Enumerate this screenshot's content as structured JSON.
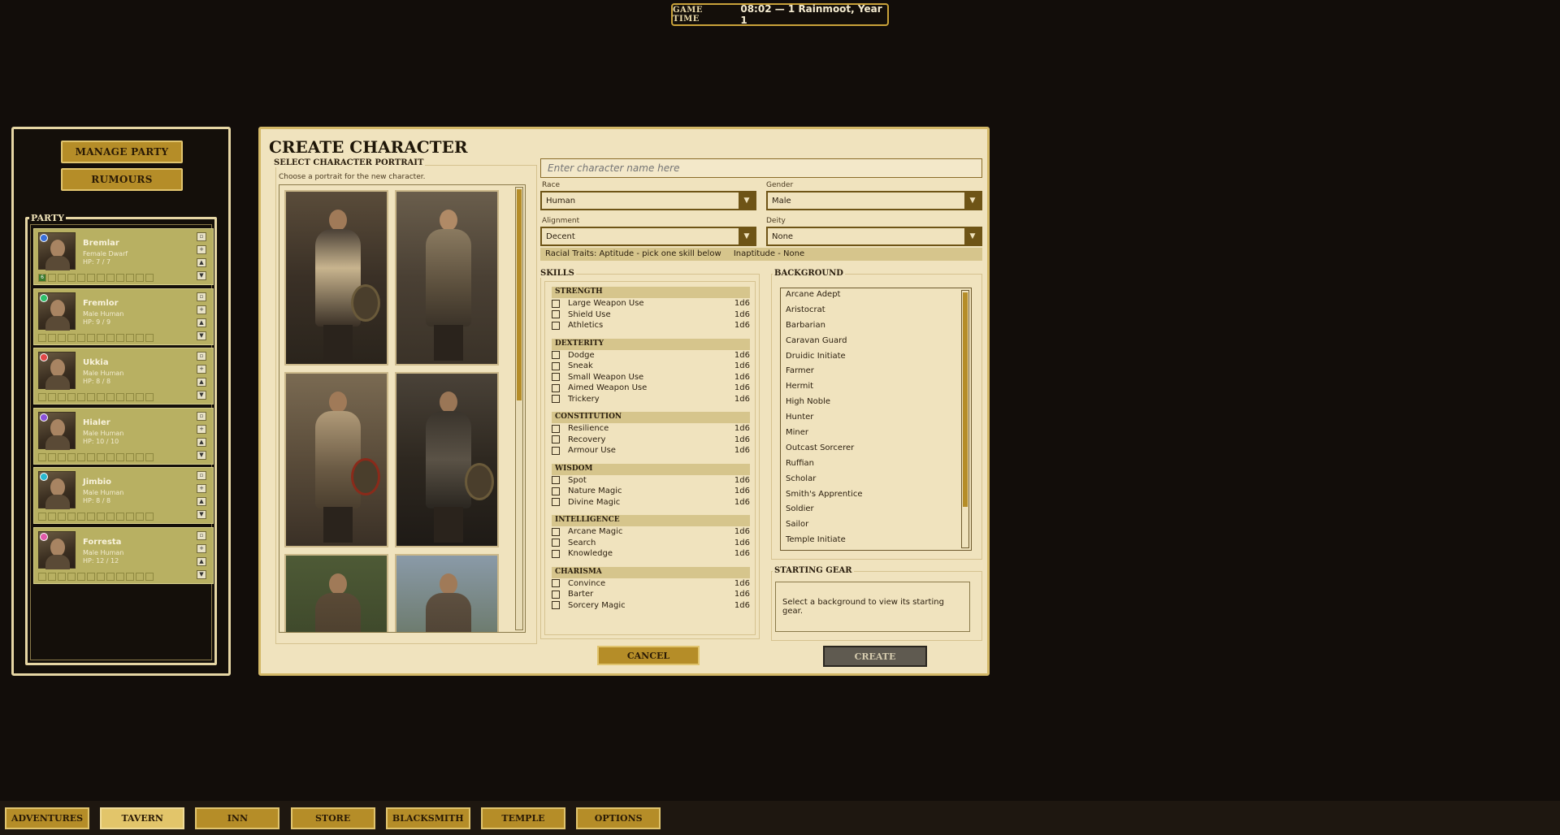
{
  "game_time": {
    "label": "GAME TIME",
    "value": "08:02 — 1 Rainmoot, Year 1"
  },
  "left_panel": {
    "manage_party": "MANAGE PARTY",
    "rumours": "RUMOURS",
    "party_title": "PARTY",
    "members": [
      {
        "name": "Bremlar",
        "info": "Female   Dwarf",
        "hp": "HP:  7 / 7",
        "dot_color": "#3a6fd8",
        "badge": "6"
      },
      {
        "name": "Fremlor",
        "info": "Male   Human",
        "hp": "HP:  9 / 9",
        "dot_color": "#2fbf6a",
        "badge": ""
      },
      {
        "name": "Ukkia",
        "info": "Male   Human",
        "hp": "HP:  8 / 8",
        "dot_color": "#e04848",
        "badge": ""
      },
      {
        "name": "Hialer",
        "info": "Male   Human",
        "hp": "HP:  10 / 10",
        "dot_color": "#8a52d8",
        "badge": ""
      },
      {
        "name": "Jimbio",
        "info": "Male   Human",
        "hp": "HP:  8 / 8",
        "dot_color": "#2ab8d0",
        "badge": ""
      },
      {
        "name": "Forresta",
        "info": "Male   Human",
        "hp": "HP:  12 / 12",
        "dot_color": "#e05aa8",
        "badge": ""
      }
    ]
  },
  "create": {
    "title": "CREATE CHARACTER",
    "portrait_label": "SELECT CHARACTER PORTRAIT",
    "portrait_hint": "Choose a portrait for the new character.",
    "name_placeholder": "Enter character name here",
    "race_label": "Race",
    "race_value": "Human",
    "gender_label": "Gender",
    "gender_value": "Male",
    "alignment_label": "Alignment",
    "alignment_value": "Decent",
    "deity_label": "Deity",
    "deity_value": "None",
    "traits_aptitude": "Racial Traits: Aptitude - pick one skill below",
    "traits_inaptitude": "Inaptitude - None",
    "skills_label": "SKILLS",
    "skill_groups": [
      {
        "name": "STRENGTH",
        "skills": [
          [
            "Large Weapon Use",
            "1d6"
          ],
          [
            "Shield Use",
            "1d6"
          ],
          [
            "Athletics",
            "1d6"
          ]
        ]
      },
      {
        "name": "DEXTERITY",
        "skills": [
          [
            "Dodge",
            "1d6"
          ],
          [
            "Sneak",
            "1d6"
          ],
          [
            "Small Weapon Use",
            "1d6"
          ],
          [
            "Aimed Weapon Use",
            "1d6"
          ],
          [
            "Trickery",
            "1d6"
          ]
        ]
      },
      {
        "name": "CONSTITUTION",
        "skills": [
          [
            "Resilience",
            "1d6"
          ],
          [
            "Recovery",
            "1d6"
          ],
          [
            "Armour Use",
            "1d6"
          ]
        ]
      },
      {
        "name": "WISDOM",
        "skills": [
          [
            "Spot",
            "1d6"
          ],
          [
            "Nature Magic",
            "1d6"
          ],
          [
            "Divine Magic",
            "1d6"
          ]
        ]
      },
      {
        "name": "INTELLIGENCE",
        "skills": [
          [
            "Arcane Magic",
            "1d6"
          ],
          [
            "Search",
            "1d6"
          ],
          [
            "Knowledge",
            "1d6"
          ]
        ]
      },
      {
        "name": "CHARISMA",
        "skills": [
          [
            "Convince",
            "1d6"
          ],
          [
            "Barter",
            "1d6"
          ],
          [
            "Sorcery Magic",
            "1d6"
          ]
        ]
      }
    ],
    "background_label": "BACKGROUND",
    "backgrounds": [
      "Arcane Adept",
      "Aristocrat",
      "Barbarian",
      "Caravan Guard",
      "Druidic Initiate",
      "Farmer",
      "Hermit",
      "High Noble",
      "Hunter",
      "Miner",
      "Outcast Sorcerer",
      "Ruffian",
      "Scholar",
      "Smith's Apprentice",
      "Soldier",
      "Sailor",
      "Temple Initiate"
    ],
    "gear_label": "STARTING GEAR",
    "gear_text": "Select a background to view its starting gear.",
    "cancel": "CANCEL",
    "create": "CREATE"
  },
  "nav": [
    "ADVENTURES",
    "TAVERN",
    "INN",
    "STORE",
    "BLACKSMITH",
    "TEMPLE",
    "OPTIONS"
  ],
  "nav_active": "TAVERN"
}
